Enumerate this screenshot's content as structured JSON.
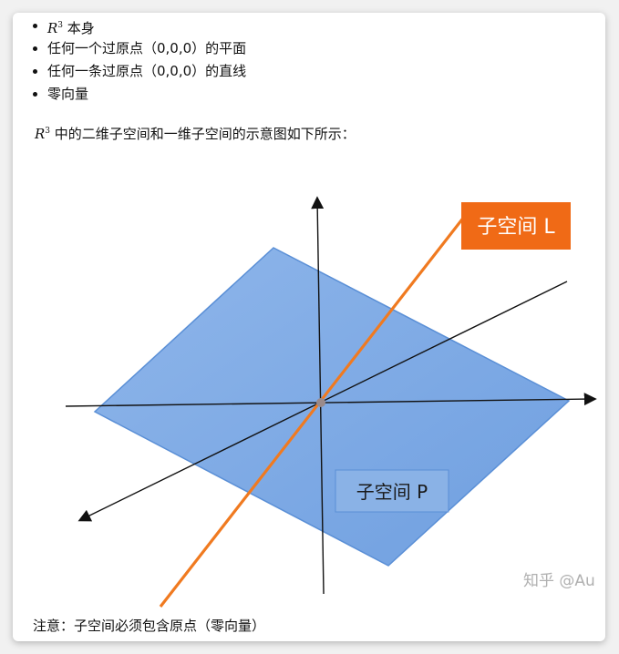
{
  "list": {
    "item1_math": "R",
    "item1_sup": "3",
    "item1_text": " 本身",
    "item2": "任何一个过原点（0,0,0）的平面",
    "item3": "任何一条过原点（0,0,0）的直线",
    "item4": "零向量"
  },
  "intro": {
    "math": "R",
    "sup": "3",
    "text": " 中的二维子空间和一维子空间的示意图如下所示："
  },
  "figure": {
    "label_line": "子空间 L",
    "label_plane": "子空间 P",
    "watermark": "知乎 @Au",
    "colors": {
      "plane_fill": "#7ba7e3",
      "plane_border": "#5a8fd6",
      "line": "#f07a20",
      "label_box": "#f06a16",
      "axis": "#111111"
    }
  },
  "note": "注意：子空间必须包含原点（零向量）"
}
